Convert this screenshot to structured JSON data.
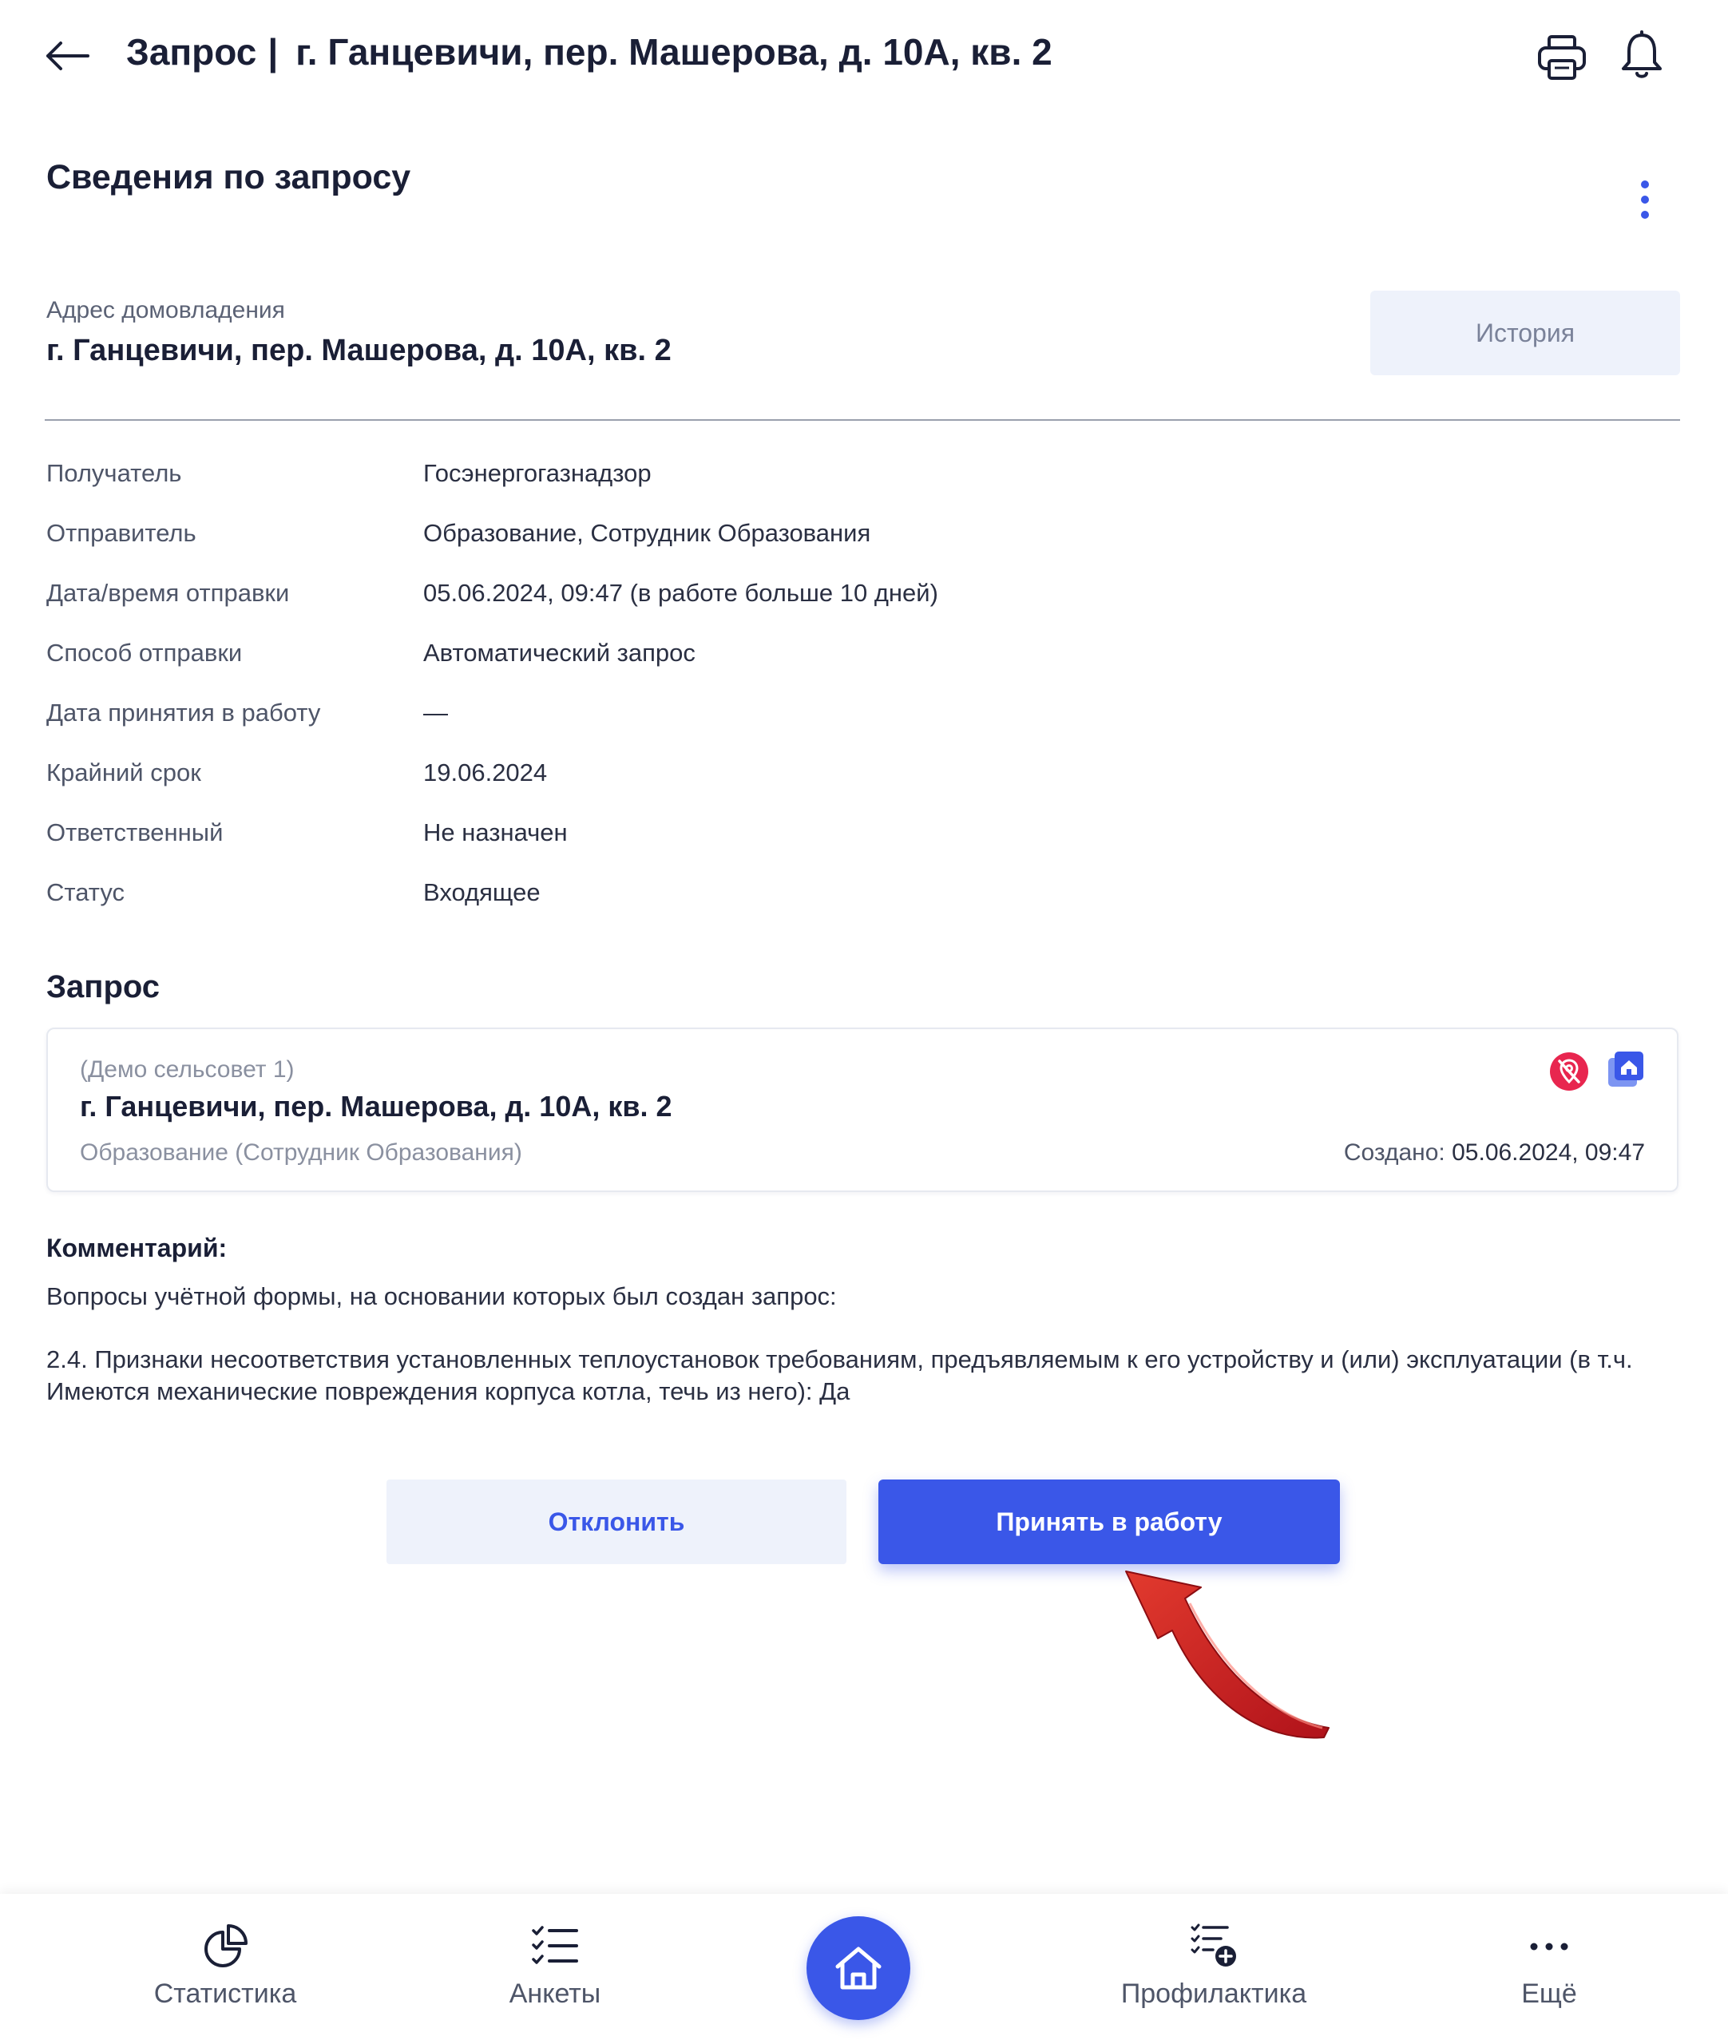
{
  "header": {
    "title": "Запрос",
    "separator": "|",
    "address": "г. Ганцевичи, пер. Машерова, д. 10А, кв. 2"
  },
  "section": {
    "title": "Сведения по запросу"
  },
  "household": {
    "label": "Адрес домовладения",
    "value": "г. Ганцевичи, пер. Машерова, д. 10А, кв. 2",
    "history_button": "История"
  },
  "details": [
    {
      "label": "Получатель",
      "value": "Госэнергогазнадзор"
    },
    {
      "label": "Отправитель",
      "value": "Образование, Сотрудник Образования"
    },
    {
      "label": "Дата/время отправки",
      "value": "05.06.2024, 09:47 (в работе больше 10 дней)"
    },
    {
      "label": "Способ отправки",
      "value": "Автоматический запрос"
    },
    {
      "label": "Дата принятия в работу",
      "value": "—"
    },
    {
      "label": "Крайний срок",
      "value": "19.06.2024"
    },
    {
      "label": "Ответственный",
      "value": "Не назначен"
    },
    {
      "label": "Статус",
      "value": "Входящее"
    }
  ],
  "request": {
    "title": "Запрос",
    "card": {
      "council": "(Демо сельсовет 1)",
      "address": "г. Ганцевичи, пер. Машерова, д. 10А, кв. 2",
      "organization": "Образование (Сотрудник Образования)",
      "created_label": "Создано:",
      "created_value": "05.06.2024, 09:47",
      "icons": [
        "location-off-icon",
        "house-gallery-icon"
      ]
    }
  },
  "comment": {
    "label": "Комментарий:",
    "intro": "Вопросы учётной формы, на основании которых был создан запрос:",
    "text": "2.4. Признаки несоответствия установленных теплоустановок требованиям, предъявляемым к его устройству и (или) эксплуатации (в т.ч. Имеются механические повреждения корпуса котла, течь из него): Да"
  },
  "actions": {
    "reject": "Отклонить",
    "accept": "Принять в работу"
  },
  "bottom_nav": {
    "items": [
      {
        "label": "Статистика",
        "icon": "pie-chart-icon"
      },
      {
        "label": "Анкеты",
        "icon": "checklist-icon"
      },
      {
        "label": "",
        "icon": "home-icon"
      },
      {
        "label": "Профилактика",
        "icon": "checklist-add-icon"
      },
      {
        "label": "Ещё",
        "icon": "more-icon"
      }
    ]
  },
  "colors": {
    "accent": "#3a57e8",
    "danger": "#e8264f",
    "text": "#1a1f36",
    "muted": "#8a90a0",
    "soft_button": "#eef2fb"
  }
}
